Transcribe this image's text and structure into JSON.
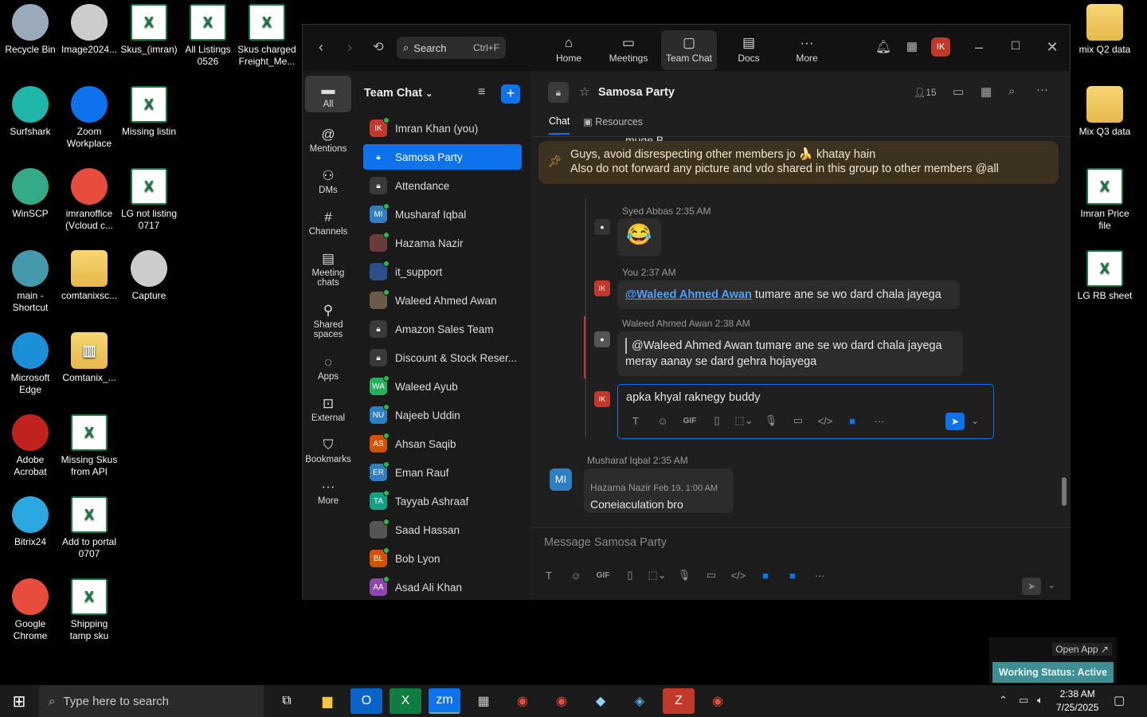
{
  "desktop_left": [
    {
      "label": "Recycle Bin",
      "icon": "recycle-bin-icon"
    },
    {
      "label": "Image2024...",
      "icon": "image-file-icon"
    },
    {
      "label": "Skus_(imran)",
      "icon": "excel-file-icon"
    },
    {
      "label": "All Listings 0526",
      "icon": "excel-file-icon"
    },
    {
      "label": "Skus charged Freight_Me...",
      "icon": "excel-file-icon"
    },
    {
      "label": "Surfshark",
      "icon": "surfshark-icon"
    },
    {
      "label": "Zoom Workplace",
      "icon": "zoom-icon"
    },
    {
      "label": "Missing listin",
      "icon": "excel-file-icon"
    },
    {
      "label": "WinSCP",
      "icon": "winscp-icon"
    },
    {
      "label": "imranoffice (Vcloud c...",
      "icon": "chrome-icon"
    },
    {
      "label": "LG not listing 0717",
      "icon": "excel-file-icon"
    },
    {
      "label": "main - Shortcut",
      "icon": "shortcut-icon"
    },
    {
      "label": "comtanixsc...",
      "icon": "folder-icon"
    },
    {
      "label": "Capture",
      "icon": "image-file-icon"
    },
    {
      "label": "Microsoft Edge",
      "icon": "edge-icon"
    },
    {
      "label": "Comtanix_...",
      "icon": "zip-folder-icon"
    },
    {
      "label": "Adobe Acrobat",
      "icon": "acrobat-icon"
    },
    {
      "label": "Missing Skus from API",
      "icon": "excel-file-icon"
    },
    {
      "label": "Bitrix24",
      "icon": "bitrix-icon"
    },
    {
      "label": "Add to portal 0707",
      "icon": "excel-file-icon"
    },
    {
      "label": "Google Chrome",
      "icon": "chrome-icon"
    },
    {
      "label": "Shipping tamp sku",
      "icon": "excel-file-icon"
    }
  ],
  "desktop_right": [
    {
      "label": "mix Q2 data",
      "icon": "folder-icon"
    },
    {
      "label": "Mix Q3 data",
      "icon": "folder-icon"
    },
    {
      "label": "Imran Price file",
      "icon": "excel-file-icon"
    },
    {
      "label": "LG RB sheet",
      "icon": "excel-file-icon"
    }
  ],
  "titlebar": {
    "search_placeholder": "Search",
    "search_shortcut": "Ctrl+F",
    "nav": [
      {
        "label": "Home"
      },
      {
        "label": "Meetings"
      },
      {
        "label": "Team Chat"
      },
      {
        "label": "Docs"
      },
      {
        "label": "More"
      }
    ],
    "avatar": "IK"
  },
  "rail": [
    {
      "label": "All"
    },
    {
      "label": "Mentions"
    },
    {
      "label": "DMs"
    },
    {
      "label": "Channels"
    },
    {
      "label": "Meeting chats"
    },
    {
      "label": "Shared spaces"
    },
    {
      "label": "Apps"
    },
    {
      "label": "External"
    },
    {
      "label": "Bookmarks"
    },
    {
      "label": "More"
    }
  ],
  "chatlist": {
    "title": "Team Chat",
    "items": [
      {
        "name": "Imran Khan (you)",
        "initials": "IK",
        "color": "#c0392b"
      },
      {
        "name": "Samosa Party",
        "initials": "",
        "color": ""
      },
      {
        "name": "Attendance",
        "initials": "",
        "color": ""
      },
      {
        "name": "Musharaf Iqbal",
        "initials": "MI",
        "color": "#2d7fc1"
      },
      {
        "name": "Hazama Nazir",
        "initials": "",
        "color": "#6b3a3a"
      },
      {
        "name": "it_support",
        "initials": "",
        "color": "#2b4f8a"
      },
      {
        "name": "Waleed Ahmed Awan",
        "initials": "",
        "color": "#6b5a4a"
      },
      {
        "name": "Amazon Sales Team",
        "initials": "",
        "color": ""
      },
      {
        "name": "Discount & Stock Reser...",
        "initials": "",
        "color": ""
      },
      {
        "name": "Waleed Ayub",
        "initials": "WA",
        "color": "#27ae60"
      },
      {
        "name": "Najeeb Uddin",
        "initials": "NU",
        "color": "#2d7fc1"
      },
      {
        "name": "Ahsan Saqib",
        "initials": "AS",
        "color": "#d35400"
      },
      {
        "name": "Eman Rauf",
        "initials": "ER",
        "color": "#2d7fc1"
      },
      {
        "name": "Tayyab Ashraaf",
        "initials": "TA",
        "color": "#16a085"
      },
      {
        "name": "Saad Hassan",
        "initials": "",
        "color": "#555"
      },
      {
        "name": "Bob Lyon",
        "initials": "BL",
        "color": "#d35400"
      },
      {
        "name": "Asad Ali Khan",
        "initials": "AA",
        "color": "#8e44ad"
      }
    ]
  },
  "channel": {
    "title": "Samosa Party",
    "members": "15",
    "tabs": [
      "Chat",
      "Resources"
    ],
    "pinned_line1": "Guys, avoid disrespecting other members jo 🍌 khatay hain",
    "pinned_line2": "Also do not forward any picture and vdo shared in this group to other members @all",
    "partial_top": "muge B",
    "messages": [
      {
        "sender": "Syed Abbas",
        "time": "2:35 AM",
        "text": "😂"
      },
      {
        "sender": "You",
        "time": "2:37 AM",
        "mention": "@Waleed Ahmed Awan",
        "text": " tumare ane se wo dard chala jayega",
        "initials": "IK"
      },
      {
        "sender": "Waleed Ahmed Awan",
        "time": "2:38 AM",
        "quote": "@Waleed Ahmed Awan tumare ane se wo dard chala jayega",
        "text": "meray aanay se dard gehra hojayega"
      }
    ],
    "reply_draft": "apka khyal raknegy  buddy ",
    "reply_initials": "IK",
    "lower": [
      {
        "sender": "Musharaf Iqbal",
        "time": "2:35 AM",
        "initials": "MI"
      },
      {
        "sender": "Hazama Nazir",
        "time": "Feb 19, 1:00 AM",
        "text": "Coneiaculation bro"
      }
    ],
    "composer_placeholder": "Message Samosa Party"
  },
  "status_widget": {
    "open_app": "Open App ↗",
    "status": "Working Status: Active"
  },
  "taskbar": {
    "search_placeholder": "Type here to search",
    "time": "2:38 AM",
    "date": "7/25/2025"
  }
}
